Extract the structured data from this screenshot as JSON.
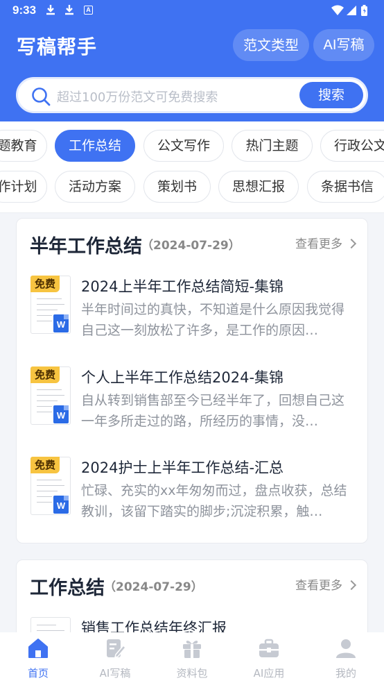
{
  "status_bar": {
    "time": "9:33"
  },
  "header": {
    "title": "写稿帮手",
    "btn_template_types": "范文类型",
    "btn_ai_write": "AI写稿"
  },
  "search": {
    "placeholder": "超过100万份范文可免费搜索",
    "button_label": "搜索"
  },
  "categories": {
    "row1": [
      "题教育",
      "工作总结",
      "公文写作",
      "热门主题",
      "行政公文"
    ],
    "row2": [
      "作计划",
      "活动方案",
      "策划书",
      "思想汇报",
      "条据书信"
    ],
    "active": "工作总结"
  },
  "sections": [
    {
      "title": "半年工作总结",
      "date": "（2024-07-29）",
      "more": "查看更多",
      "items": [
        {
          "badge": "免费",
          "title": "2024上半年工作总结简短-集锦",
          "desc": "半年时间过的真快，不知道是什么原因我觉得自己这一刻放松了许多，是工作的原因…"
        },
        {
          "badge": "免费",
          "title": "个人上半年工作总结2024-集锦",
          "desc": "自从转到销售部至今已经半年了，回想自己这一年多所走过的路，所经历的事情，没…"
        },
        {
          "badge": "免费",
          "title": "2024护士上半年工作总结-汇总",
          "desc": "忙碌、充实的xx年匆匆而过，盘点收获，总结教训，该留下踏实的脚步;沉淀积累，触…"
        }
      ]
    },
    {
      "title": "工作总结",
      "date": "（2024-07-29）",
      "more": "查看更多",
      "items": [
        {
          "title": "销售工作总结年终汇报"
        }
      ]
    }
  ],
  "bottom_nav": [
    {
      "label": "首页",
      "icon": "home-icon",
      "active": true
    },
    {
      "label": "AI写稿",
      "icon": "edit-doc-icon",
      "active": false
    },
    {
      "label": "资料包",
      "icon": "gift-icon",
      "active": false
    },
    {
      "label": "AI应用",
      "icon": "toolbox-icon",
      "active": false
    },
    {
      "label": "我的",
      "icon": "user-icon",
      "active": false
    }
  ],
  "colors": {
    "primary": "#3f72f2",
    "badge": "#f7c441"
  }
}
